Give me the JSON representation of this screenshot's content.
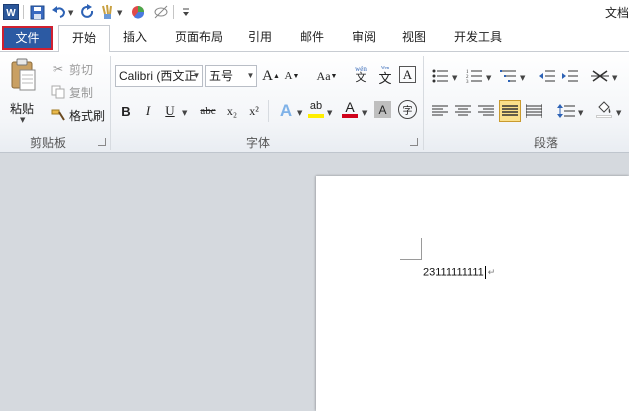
{
  "titlebar": {
    "doc_title": "文档",
    "icons": [
      "word-logo-icon",
      "save-icon",
      "undo-icon",
      "redo-icon",
      "format-painter-icon",
      "color-wheel-icon",
      "no-style-icon",
      "customize-qat-icon"
    ]
  },
  "tabs": {
    "file": "文件",
    "home": "开始",
    "insert": "插入",
    "page_layout": "页面布局",
    "references": "引用",
    "mailings": "邮件",
    "review": "审阅",
    "view": "视图",
    "developer": "开发工具"
  },
  "clipboard": {
    "paste": "粘贴",
    "cut": "剪切",
    "copy": "复制",
    "format_painter": "格式刷",
    "group_label": "剪贴板"
  },
  "font": {
    "font_name": "Calibri (西文正",
    "font_size": "五号",
    "bold": "B",
    "italic": "I",
    "underline": "U",
    "strikethrough": "abc",
    "subscript": "x₂",
    "superscript": "x²",
    "grow": "A",
    "shrink": "A",
    "change_case": "Aa",
    "pinyin_top": "wén",
    "pinyin_char": "文",
    "border_char": "A",
    "text_effect": "A",
    "highlight": "ab",
    "font_color": "A",
    "shading": "A",
    "enclose": "字",
    "group_label": "字体"
  },
  "paragraph": {
    "group_label": "段落"
  },
  "document": {
    "text": "23111111111"
  },
  "colors": {
    "file_tab": "#2c5aa3",
    "file_border": "#d02030",
    "highlight_yellow": "#ffee00",
    "font_red": "#d0021b",
    "active_align": "#fbe08a"
  }
}
